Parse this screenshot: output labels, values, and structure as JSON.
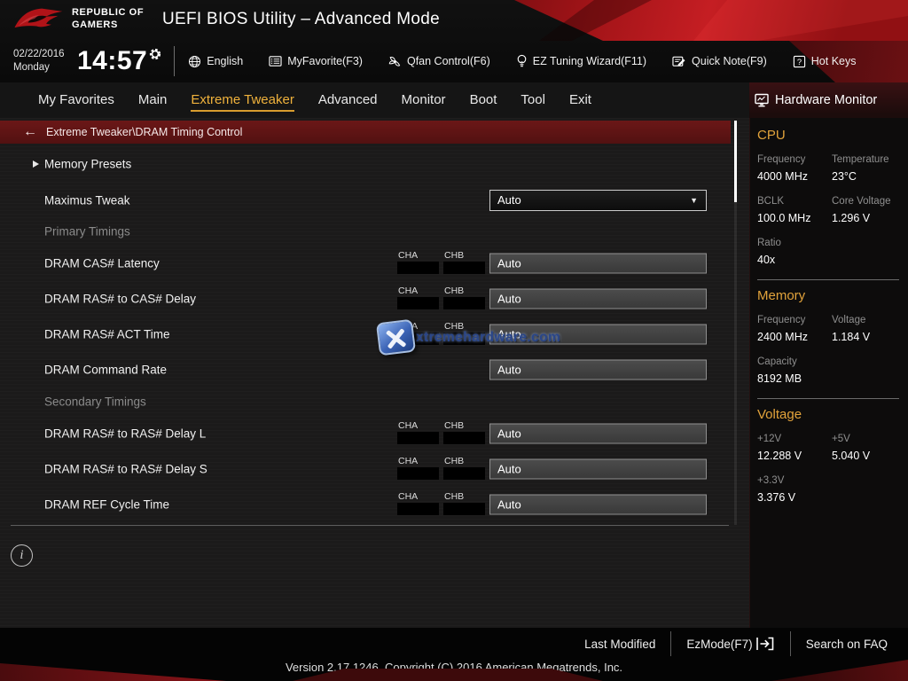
{
  "header": {
    "brand_line1": "REPUBLIC OF",
    "brand_line2": "GAMERS",
    "title": "UEFI BIOS Utility – Advanced Mode"
  },
  "topbar": {
    "date": "02/22/2016",
    "day": "Monday",
    "time": "14:57",
    "items": [
      {
        "icon": "globe-icon",
        "label": "English"
      },
      {
        "icon": "myfavorite-icon",
        "label": "MyFavorite(F3)"
      },
      {
        "icon": "qfan-icon",
        "label": "Qfan Control(F6)"
      },
      {
        "icon": "ez-tuning-icon",
        "label": "EZ Tuning Wizard(F11)"
      },
      {
        "icon": "quick-note-icon",
        "label": "Quick Note(F9)"
      },
      {
        "icon": "hot-keys-icon",
        "label": "Hot Keys"
      }
    ]
  },
  "tabs": [
    {
      "label": "My Favorites",
      "active": false
    },
    {
      "label": "Main",
      "active": false
    },
    {
      "label": "Extreme Tweaker",
      "active": true
    },
    {
      "label": "Advanced",
      "active": false
    },
    {
      "label": "Monitor",
      "active": false
    },
    {
      "label": "Boot",
      "active": false
    },
    {
      "label": "Tool",
      "active": false
    },
    {
      "label": "Exit",
      "active": false
    }
  ],
  "breadcrumb": {
    "text": "Extreme Tweaker\\DRAM Timing Control"
  },
  "settings": {
    "rows": [
      {
        "type": "link",
        "label": "Memory Presets"
      },
      {
        "type": "dropdown",
        "label": "Maximus Tweak",
        "value": "Auto"
      },
      {
        "type": "section",
        "label": "Primary Timings"
      },
      {
        "type": "field",
        "label": "DRAM CAS# Latency",
        "channels": [
          "CHA",
          "CHB"
        ],
        "value": "Auto"
      },
      {
        "type": "field",
        "label": "DRAM RAS# to CAS# Delay",
        "channels": [
          "CHA",
          "CHB"
        ],
        "value": "Auto"
      },
      {
        "type": "field",
        "label": "DRAM RAS# ACT Time",
        "channels": [
          "CHA",
          "CHB"
        ],
        "value": "Auto"
      },
      {
        "type": "field",
        "label": "DRAM Command Rate",
        "channels": [],
        "value": "Auto"
      },
      {
        "type": "section",
        "label": "Secondary Timings"
      },
      {
        "type": "field",
        "label": "DRAM RAS# to RAS# Delay L",
        "channels": [
          "CHA",
          "CHB"
        ],
        "value": "Auto"
      },
      {
        "type": "field",
        "label": "DRAM RAS# to RAS# Delay S",
        "channels": [
          "CHA",
          "CHB"
        ],
        "value": "Auto"
      },
      {
        "type": "field",
        "label": "DRAM REF Cycle Time",
        "channels": [
          "CHA",
          "CHB"
        ],
        "value": "Auto"
      }
    ]
  },
  "hardware_monitor": {
    "title": "Hardware Monitor",
    "sections": [
      {
        "title": "CPU",
        "rows": [
          [
            {
              "label": "Frequency",
              "value": "4000 MHz"
            },
            {
              "label": "Temperature",
              "value": "23°C"
            }
          ],
          [
            {
              "label": "BCLK",
              "value": "100.0 MHz"
            },
            {
              "label": "Core Voltage",
              "value": "1.296 V"
            }
          ],
          [
            {
              "label": "Ratio",
              "value": "40x"
            }
          ]
        ]
      },
      {
        "title": "Memory",
        "rows": [
          [
            {
              "label": "Frequency",
              "value": "2400 MHz"
            },
            {
              "label": "Voltage",
              "value": "1.184 V"
            }
          ],
          [
            {
              "label": "Capacity",
              "value": "8192 MB"
            }
          ]
        ]
      },
      {
        "title": "Voltage",
        "rows": [
          [
            {
              "label": "+12V",
              "value": "12.288 V"
            },
            {
              "label": "+5V",
              "value": "5.040 V"
            }
          ],
          [
            {
              "label": "+3.3V",
              "value": "3.376 V"
            }
          ]
        ]
      }
    ]
  },
  "footer": {
    "links": [
      {
        "label": "Last Modified"
      },
      {
        "label": "EzMode(F7)",
        "icon": "ezmode-exit-icon"
      },
      {
        "label": "Search on FAQ"
      }
    ],
    "version": "Version 2.17.1246. Copyright (C) 2016 American Megatrends, Inc."
  },
  "watermark": {
    "text": "xtremehardware.com"
  },
  "colors": {
    "accent_gold": "#f0b23c",
    "breadcrumb_red": "#5e1313",
    "header_red": "#bb181d"
  }
}
